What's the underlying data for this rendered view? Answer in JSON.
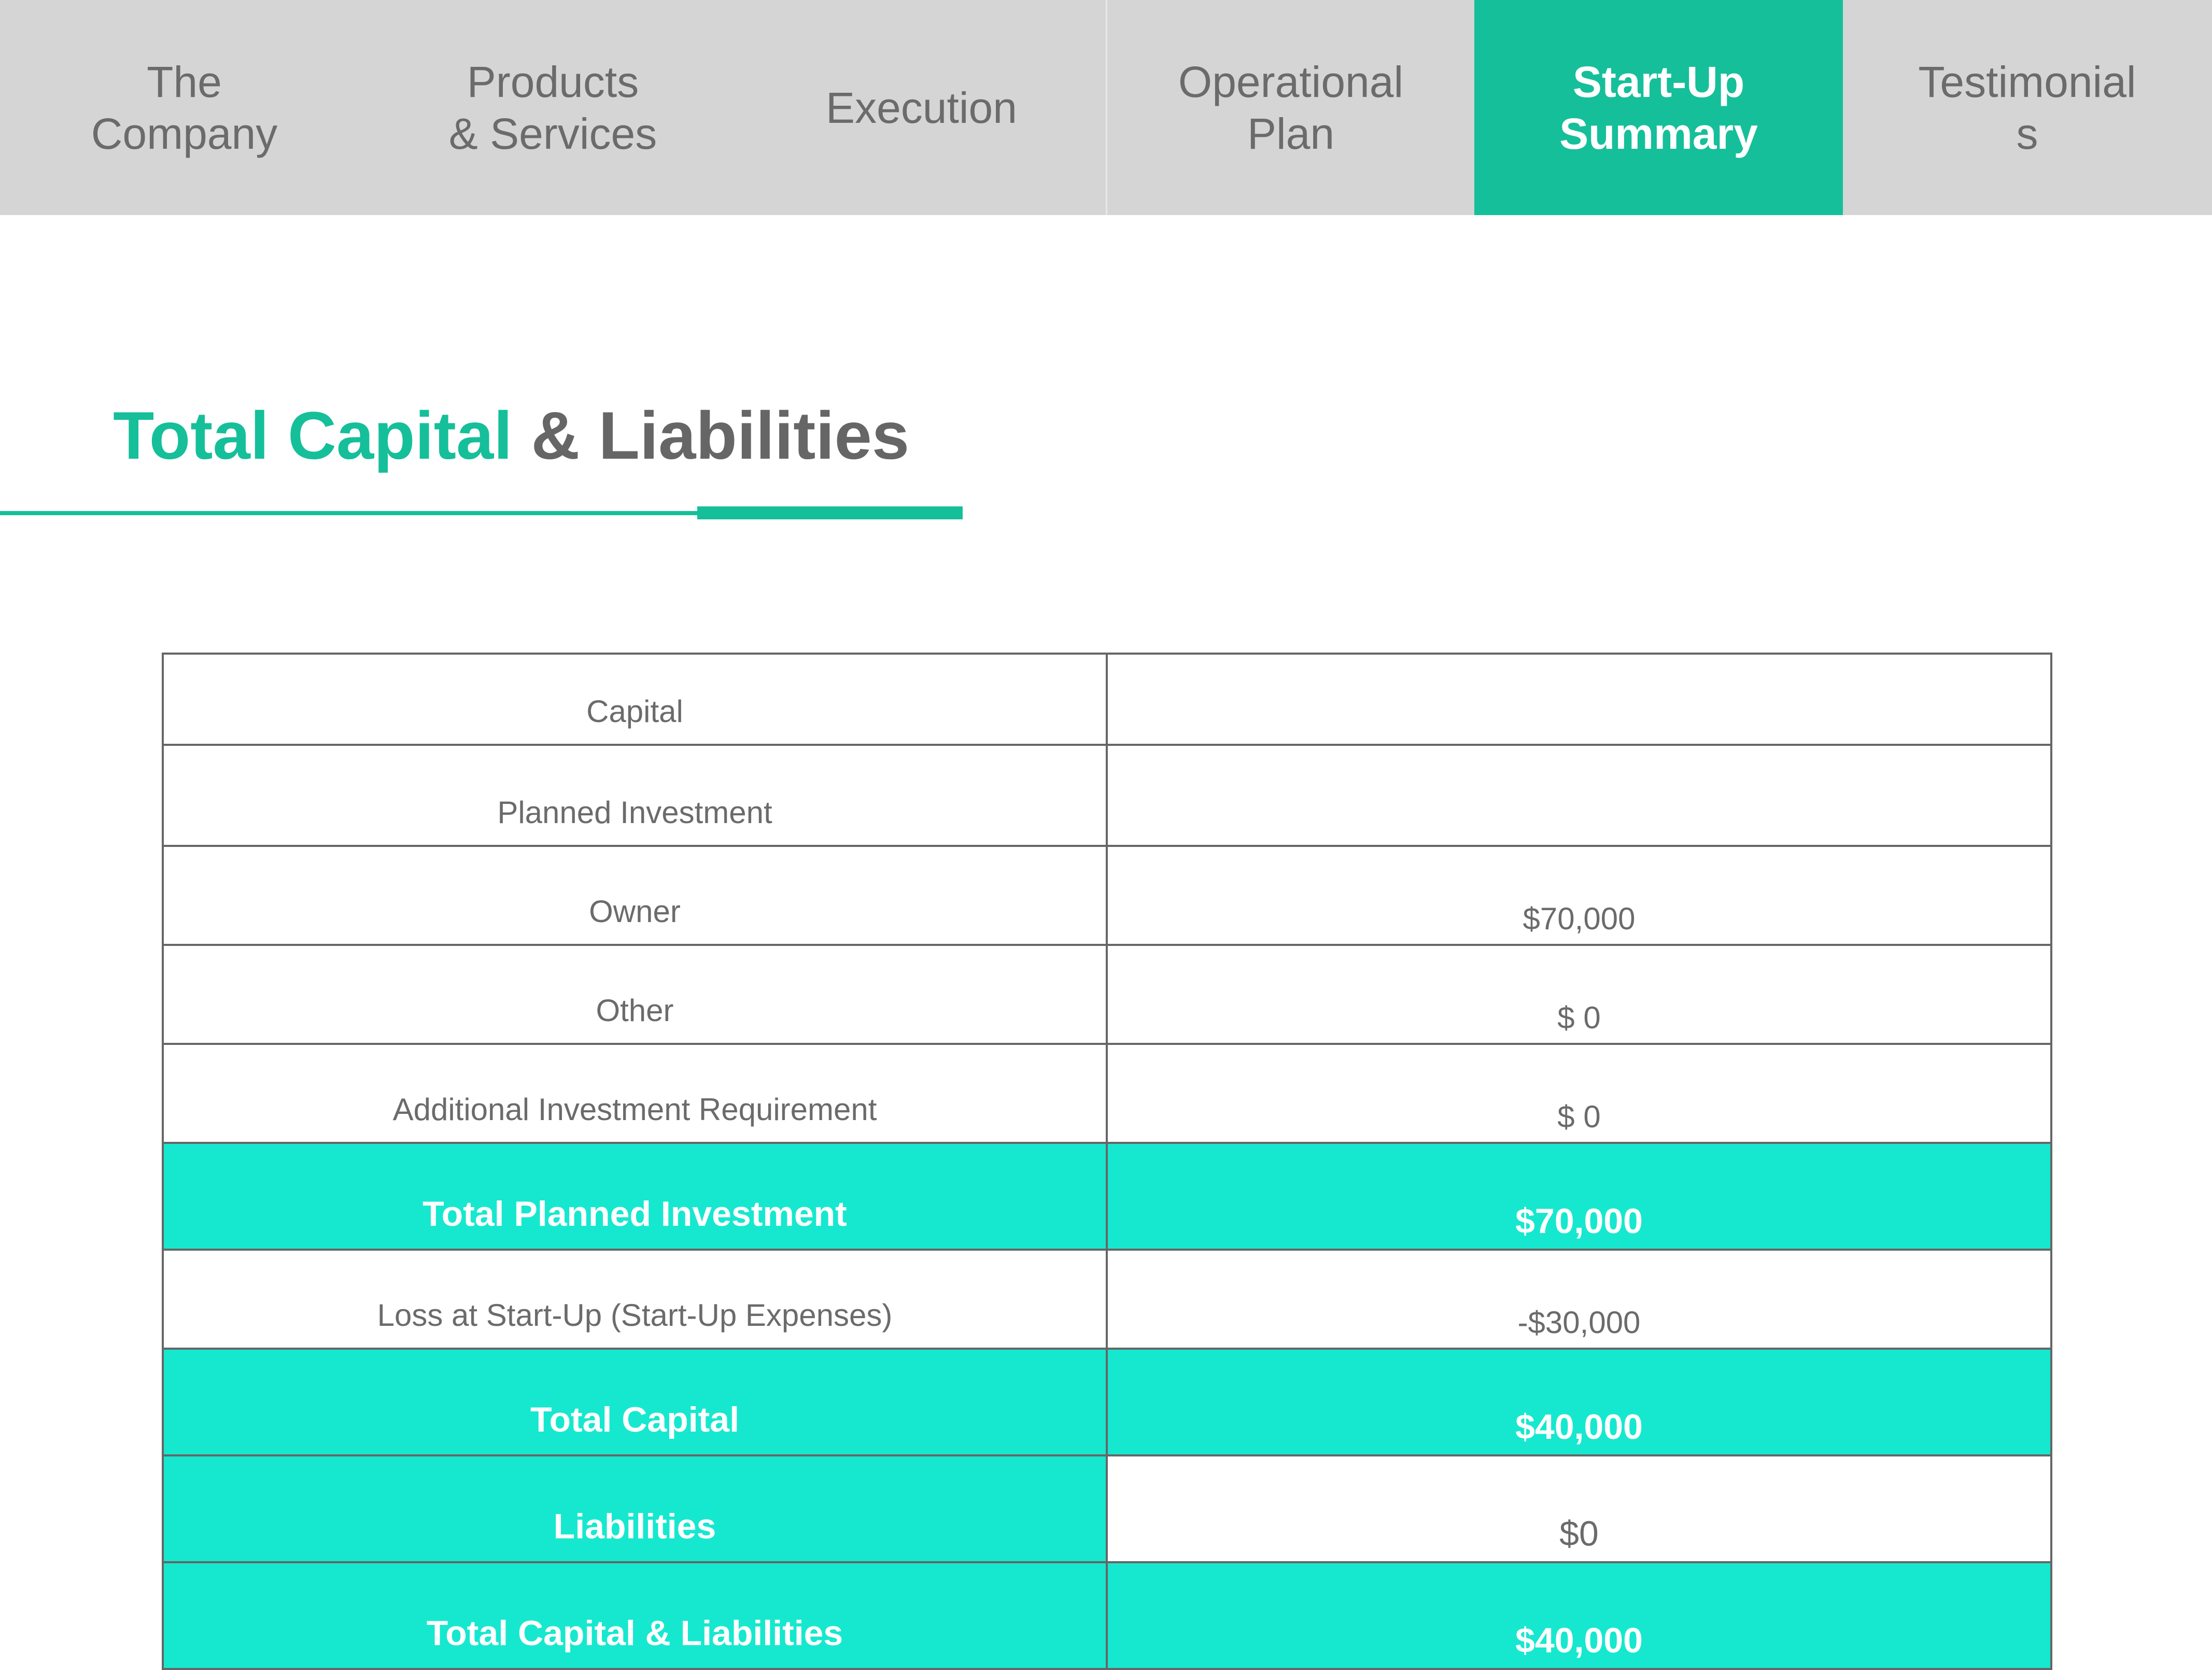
{
  "nav": {
    "tabs": [
      {
        "label": "The\nCompany",
        "active": false
      },
      {
        "label": "Products\n& Services",
        "active": false
      },
      {
        "label": "Execution",
        "active": false
      },
      {
        "label": "Operational\nPlan",
        "active": false
      },
      {
        "label": "Start-Up\nSummary",
        "active": true
      },
      {
        "label": "Testimonial\ns",
        "active": false
      }
    ]
  },
  "title": {
    "accent": "Total Capital",
    "rest": " & Liabilities"
  },
  "table": {
    "rows": [
      {
        "label": "Capital",
        "value": ""
      },
      {
        "label": "Planned Investment",
        "value": ""
      },
      {
        "label": "Owner",
        "value": "$70,000"
      },
      {
        "label": "Other",
        "value": "$ 0"
      },
      {
        "label": "Additional Investment Requirement",
        "value": "$ 0"
      },
      {
        "label": "Total Planned Investment",
        "value": "$70,000"
      },
      {
        "label": "Loss at Start-Up (Start-Up Expenses)",
        "value": "-$30,000"
      },
      {
        "label": "Total Capital",
        "value": "$40,000"
      },
      {
        "label": "Liabilities",
        "value": "$0"
      },
      {
        "label": "Total Capital & Liabilities",
        "value": "$40,000"
      }
    ]
  },
  "colors": {
    "accent": "#15bf9a",
    "highlight_row": "#16e8cf",
    "nav_bg": "#d5d5d5",
    "text_gray": "#6b6b6b"
  }
}
